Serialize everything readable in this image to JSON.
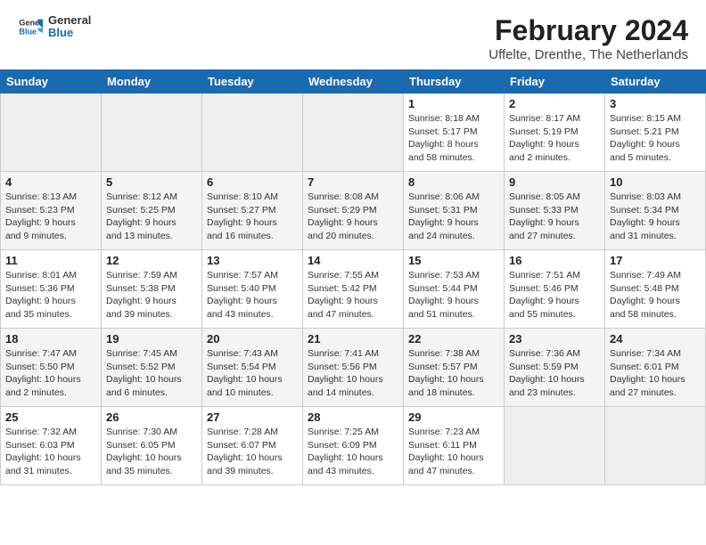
{
  "header": {
    "logo_line1": "General",
    "logo_line2": "Blue",
    "month_year": "February 2024",
    "location": "Uffelte, Drenthe, The Netherlands"
  },
  "weekdays": [
    "Sunday",
    "Monday",
    "Tuesday",
    "Wednesday",
    "Thursday",
    "Friday",
    "Saturday"
  ],
  "weeks": [
    [
      {
        "day": "",
        "info": ""
      },
      {
        "day": "",
        "info": ""
      },
      {
        "day": "",
        "info": ""
      },
      {
        "day": "",
        "info": ""
      },
      {
        "day": "1",
        "info": "Sunrise: 8:18 AM\nSunset: 5:17 PM\nDaylight: 8 hours\nand 58 minutes."
      },
      {
        "day": "2",
        "info": "Sunrise: 8:17 AM\nSunset: 5:19 PM\nDaylight: 9 hours\nand 2 minutes."
      },
      {
        "day": "3",
        "info": "Sunrise: 8:15 AM\nSunset: 5:21 PM\nDaylight: 9 hours\nand 5 minutes."
      }
    ],
    [
      {
        "day": "4",
        "info": "Sunrise: 8:13 AM\nSunset: 5:23 PM\nDaylight: 9 hours\nand 9 minutes."
      },
      {
        "day": "5",
        "info": "Sunrise: 8:12 AM\nSunset: 5:25 PM\nDaylight: 9 hours\nand 13 minutes."
      },
      {
        "day": "6",
        "info": "Sunrise: 8:10 AM\nSunset: 5:27 PM\nDaylight: 9 hours\nand 16 minutes."
      },
      {
        "day": "7",
        "info": "Sunrise: 8:08 AM\nSunset: 5:29 PM\nDaylight: 9 hours\nand 20 minutes."
      },
      {
        "day": "8",
        "info": "Sunrise: 8:06 AM\nSunset: 5:31 PM\nDaylight: 9 hours\nand 24 minutes."
      },
      {
        "day": "9",
        "info": "Sunrise: 8:05 AM\nSunset: 5:33 PM\nDaylight: 9 hours\nand 27 minutes."
      },
      {
        "day": "10",
        "info": "Sunrise: 8:03 AM\nSunset: 5:34 PM\nDaylight: 9 hours\nand 31 minutes."
      }
    ],
    [
      {
        "day": "11",
        "info": "Sunrise: 8:01 AM\nSunset: 5:36 PM\nDaylight: 9 hours\nand 35 minutes."
      },
      {
        "day": "12",
        "info": "Sunrise: 7:59 AM\nSunset: 5:38 PM\nDaylight: 9 hours\nand 39 minutes."
      },
      {
        "day": "13",
        "info": "Sunrise: 7:57 AM\nSunset: 5:40 PM\nDaylight: 9 hours\nand 43 minutes."
      },
      {
        "day": "14",
        "info": "Sunrise: 7:55 AM\nSunset: 5:42 PM\nDaylight: 9 hours\nand 47 minutes."
      },
      {
        "day": "15",
        "info": "Sunrise: 7:53 AM\nSunset: 5:44 PM\nDaylight: 9 hours\nand 51 minutes."
      },
      {
        "day": "16",
        "info": "Sunrise: 7:51 AM\nSunset: 5:46 PM\nDaylight: 9 hours\nand 55 minutes."
      },
      {
        "day": "17",
        "info": "Sunrise: 7:49 AM\nSunset: 5:48 PM\nDaylight: 9 hours\nand 58 minutes."
      }
    ],
    [
      {
        "day": "18",
        "info": "Sunrise: 7:47 AM\nSunset: 5:50 PM\nDaylight: 10 hours\nand 2 minutes."
      },
      {
        "day": "19",
        "info": "Sunrise: 7:45 AM\nSunset: 5:52 PM\nDaylight: 10 hours\nand 6 minutes."
      },
      {
        "day": "20",
        "info": "Sunrise: 7:43 AM\nSunset: 5:54 PM\nDaylight: 10 hours\nand 10 minutes."
      },
      {
        "day": "21",
        "info": "Sunrise: 7:41 AM\nSunset: 5:56 PM\nDaylight: 10 hours\nand 14 minutes."
      },
      {
        "day": "22",
        "info": "Sunrise: 7:38 AM\nSunset: 5:57 PM\nDaylight: 10 hours\nand 18 minutes."
      },
      {
        "day": "23",
        "info": "Sunrise: 7:36 AM\nSunset: 5:59 PM\nDaylight: 10 hours\nand 23 minutes."
      },
      {
        "day": "24",
        "info": "Sunrise: 7:34 AM\nSunset: 6:01 PM\nDaylight: 10 hours\nand 27 minutes."
      }
    ],
    [
      {
        "day": "25",
        "info": "Sunrise: 7:32 AM\nSunset: 6:03 PM\nDaylight: 10 hours\nand 31 minutes."
      },
      {
        "day": "26",
        "info": "Sunrise: 7:30 AM\nSunset: 6:05 PM\nDaylight: 10 hours\nand 35 minutes."
      },
      {
        "day": "27",
        "info": "Sunrise: 7:28 AM\nSunset: 6:07 PM\nDaylight: 10 hours\nand 39 minutes."
      },
      {
        "day": "28",
        "info": "Sunrise: 7:25 AM\nSunset: 6:09 PM\nDaylight: 10 hours\nand 43 minutes."
      },
      {
        "day": "29",
        "info": "Sunrise: 7:23 AM\nSunset: 6:11 PM\nDaylight: 10 hours\nand 47 minutes."
      },
      {
        "day": "",
        "info": ""
      },
      {
        "day": "",
        "info": ""
      }
    ]
  ]
}
